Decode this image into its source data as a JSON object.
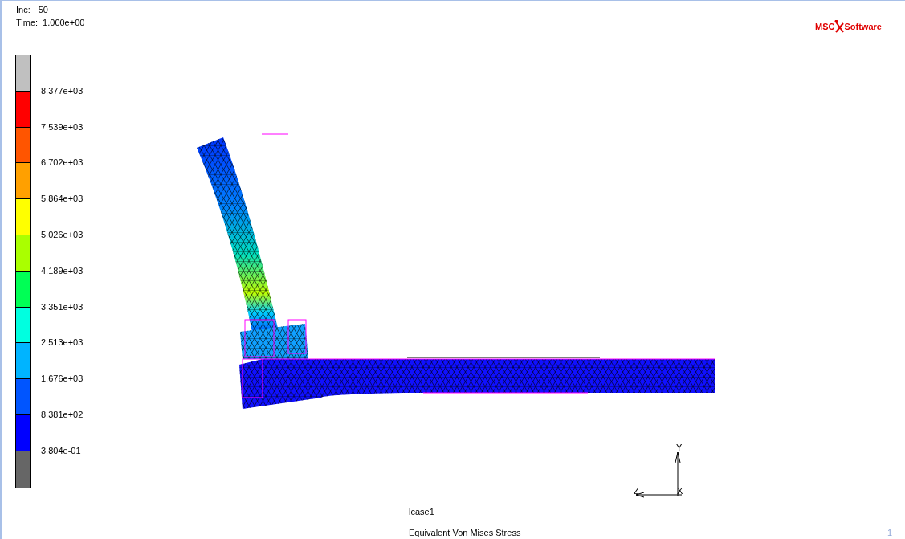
{
  "header": {
    "inc_label": "Inc:",
    "inc_value": "50",
    "time_label": "Time:",
    "time_value": "1.000e+00"
  },
  "logo": {
    "left": "MSC",
    "right": "Software"
  },
  "legend": {
    "bands": [
      {
        "color": "#c0c0c0"
      },
      {
        "color": "#ff0000"
      },
      {
        "color": "#ff5500"
      },
      {
        "color": "#ffa000"
      },
      {
        "color": "#ffff00"
      },
      {
        "color": "#aaff00"
      },
      {
        "color": "#00ff55"
      },
      {
        "color": "#00ffe0"
      },
      {
        "color": "#00b4ff"
      },
      {
        "color": "#0055ff"
      },
      {
        "color": "#0000ff"
      },
      {
        "color": "#666666"
      }
    ],
    "labels": [
      "8.377e+03",
      "7.539e+03",
      "6.702e+03",
      "5.864e+03",
      "5.026e+03",
      "4.189e+03",
      "3.351e+03",
      "2.513e+03",
      "1.676e+03",
      "8.381e+02",
      "3.804e-01"
    ]
  },
  "axes": {
    "y": "Y",
    "z": "Z",
    "x": "X"
  },
  "load_case": "lcase1",
  "result_name": "Equivalent Von Mises Stress",
  "viewport_number": "1"
}
